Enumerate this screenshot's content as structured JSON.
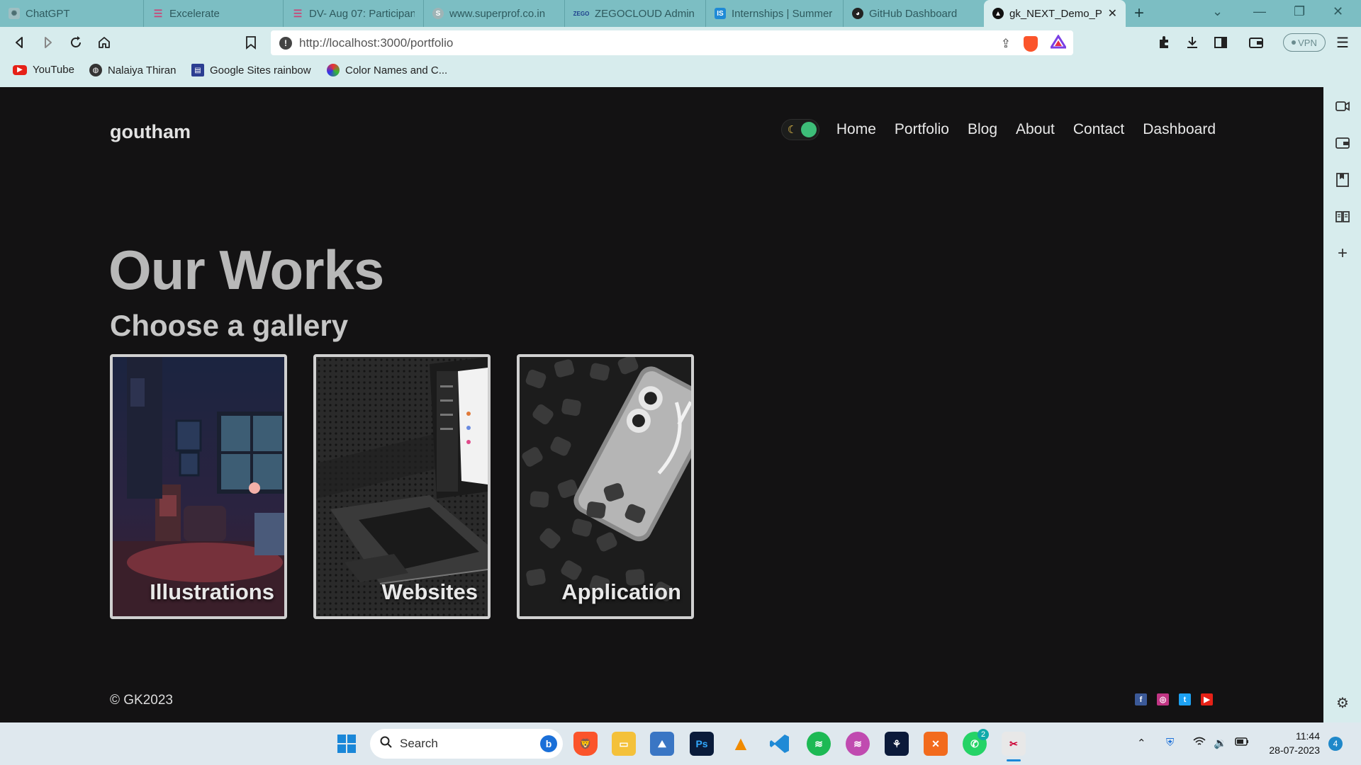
{
  "browser": {
    "tabs": [
      {
        "title": "ChatGPT",
        "icon": "chatgpt-icon"
      },
      {
        "title": "Excelerate",
        "icon": "excelerate-icon"
      },
      {
        "title": "DV- Aug 07: Participan",
        "icon": "excelerate-icon"
      },
      {
        "title": "www.superprof.co.in",
        "icon": "superprof-icon"
      },
      {
        "title": "ZEGOCLOUD Admin C",
        "icon": "zegocloud-icon"
      },
      {
        "title": "Internships | Summer I",
        "icon": "internshala-icon"
      },
      {
        "title": "GitHub Dashboard",
        "icon": "github-icon"
      },
      {
        "title": "gk_NEXT_Demo_Po",
        "icon": "nextjs-icon",
        "active": true
      }
    ],
    "url": "http://localhost:3000/portfolio",
    "vpn_label": "VPN",
    "bookmarks": [
      {
        "label": "YouTube",
        "icon": "youtube-icon"
      },
      {
        "label": "Nalaiya Thiran",
        "icon": "globe-icon"
      },
      {
        "label": "Google Sites rainbow",
        "icon": "google-sites-icon"
      },
      {
        "label": "Color Names and C...",
        "icon": "color-wheel-icon"
      }
    ]
  },
  "site": {
    "brand": "goutham",
    "nav": [
      "Home",
      "Portfolio",
      "Blog",
      "About",
      "Contact",
      "Dashboard"
    ],
    "theme_toggle": {
      "mode": "dark",
      "accent": "#3dbd78"
    },
    "heading": "Our Works",
    "subheading": "Choose a gallery",
    "galleries": [
      {
        "label": "Illustrations"
      },
      {
        "label": "Websites"
      },
      {
        "label": "Application"
      }
    ],
    "footer": {
      "copyright": "© GK2023",
      "social": [
        {
          "name": "facebook-icon",
          "color": "#3b5998"
        },
        {
          "name": "instagram-icon",
          "color": "#c13584"
        },
        {
          "name": "twitter-icon",
          "color": "#1da1f2"
        },
        {
          "name": "youtube-icon",
          "color": "#e62117"
        }
      ]
    }
  },
  "taskbar": {
    "search_placeholder": "Search",
    "time": "11:44",
    "date": "28-07-2023",
    "whatsapp_badge": "2",
    "notification_count": "4",
    "apps": [
      "brave",
      "file-explorer",
      "photos",
      "photoshop",
      "vlc",
      "vscode",
      "spotify",
      "spotify-alt",
      "acrobat",
      "xampp",
      "whatsapp",
      "snipping-tool"
    ]
  },
  "colors": {
    "page_bg": "#131213",
    "chrome_bg": "#7cbec3",
    "toolbar_bg": "#d7eced"
  }
}
